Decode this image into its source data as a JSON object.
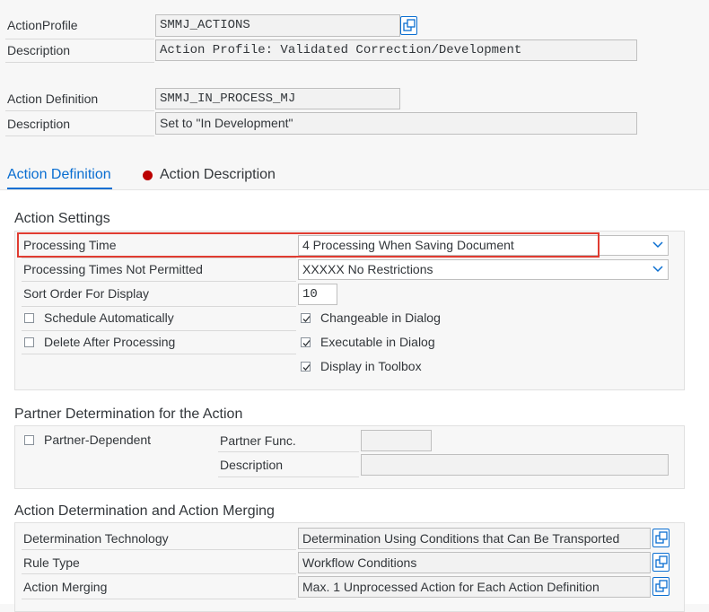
{
  "header": {
    "action_profile_label": "ActionProfile",
    "action_profile_value": "SMMJ_ACTIONS",
    "description_label": "Description",
    "description_value": "Action Profile: Validated Correction/Development",
    "action_definition_label": "Action Definition",
    "action_definition_value": "SMMJ_IN_PROCESS_MJ",
    "description2_label": "Description",
    "description2_value": "Set to \"In Development\""
  },
  "tabs": [
    {
      "label": "Action Definition",
      "active": true
    },
    {
      "label": "Action Description",
      "active": false,
      "status_dot_color": "#bb0000"
    }
  ],
  "action_settings": {
    "title": "Action Settings",
    "processing_time_label": "Processing Time",
    "processing_time_value": "4 Processing When Saving Document",
    "not_permitted_label": "Processing Times Not Permitted",
    "not_permitted_value": "XXXXX No Restrictions",
    "sort_order_label": "Sort Order For Display",
    "sort_order_value": "10",
    "schedule_auto_label": "Schedule Automatically",
    "schedule_auto_checked": false,
    "delete_after_label": "Delete After Processing",
    "delete_after_checked": false,
    "changeable_label": "Changeable in Dialog",
    "changeable_checked": true,
    "executable_label": "Executable in Dialog",
    "executable_checked": true,
    "toolbox_label": "Display in Toolbox",
    "toolbox_checked": true
  },
  "partner": {
    "title": "Partner Determination for the Action",
    "partner_dependent_label": "Partner-Dependent",
    "partner_dependent_checked": false,
    "partner_func_label": "Partner Func.",
    "partner_func_value": "",
    "description_label": "Description",
    "description_value": ""
  },
  "determination": {
    "title": "Action Determination and Action Merging",
    "technology_label": "Determination Technology",
    "technology_value": "Determination Using Conditions that Can Be Transported",
    "rule_type_label": "Rule Type",
    "rule_type_value": "Workflow Conditions",
    "merging_label": "Action Merging",
    "merging_value": "Max. 1 Unprocessed Action for Each Action Definition"
  },
  "colors": {
    "highlight": "#e03c31",
    "accent": "#0a6ed1"
  },
  "icons": {
    "value_help": "value-help-icon",
    "dropdown": "chevron-down-icon",
    "checkbox_check": "check-icon"
  }
}
